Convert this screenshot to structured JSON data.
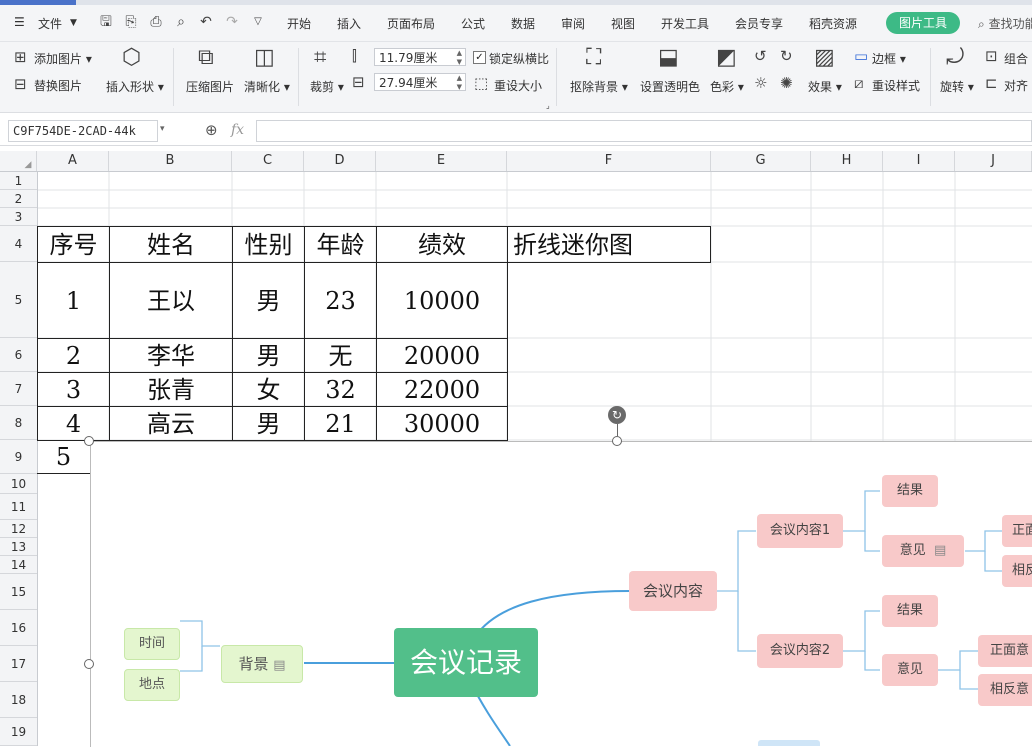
{
  "menu": {
    "file_label": "文件",
    "tabs": [
      "开始",
      "插入",
      "页面布局",
      "公式",
      "数据",
      "审阅",
      "视图",
      "开发工具",
      "会员专享",
      "稻壳资源"
    ],
    "active_tab": "图片工具",
    "search_label": "查找功能"
  },
  "ribbon": {
    "add_picture": "添加图片",
    "replace_picture": "替换图片",
    "insert_shape": "插入形状",
    "compress_picture": "压缩图片",
    "sharpen": "清晰化",
    "crop": "裁剪",
    "width_value": "11.79厘米",
    "height_value": "27.94厘米",
    "lock_ratio": "锁定纵横比",
    "reset_size": "重设大小",
    "remove_background": "抠除背景",
    "set_transparent": "设置透明色",
    "color": "色彩",
    "effects": "效果",
    "border": "边框",
    "reset_style": "重设样式",
    "rotate": "旋转",
    "group": "组合",
    "align": "对齐"
  },
  "formula_bar": {
    "name_box": "C9F754DE-2CAD-44k",
    "fx_label": "fx",
    "formula": ""
  },
  "grid": {
    "columns": [
      "A",
      "B",
      "C",
      "D",
      "E",
      "F",
      "G",
      "H",
      "I",
      "J"
    ],
    "rows": [
      "1",
      "2",
      "3",
      "4",
      "5",
      "6",
      "7",
      "8",
      "9",
      "10",
      "11",
      "12",
      "13",
      "14",
      "15",
      "16",
      "17",
      "18",
      "19"
    ]
  },
  "table": {
    "headers": [
      "序号",
      "姓名",
      "性别",
      "年龄",
      "绩效",
      "折线迷你图"
    ],
    "rows": [
      [
        "1",
        "王以",
        "男",
        "23",
        "10000"
      ],
      [
        "2",
        "李华",
        "男",
        "无",
        "20000"
      ],
      [
        "3",
        "张青",
        "女",
        "32",
        "22000"
      ],
      [
        "4",
        "高云",
        "男",
        "21",
        "30000"
      ]
    ],
    "extra_a9": "5"
  },
  "mindmap": {
    "root": "会议记录",
    "background": "背景",
    "time": "时间",
    "place": "地点",
    "content": "会议内容",
    "content1": "会议内容1",
    "content2": "会议内容2",
    "result1": "结果",
    "opinion1": "意见",
    "result2": "结果",
    "opinion2": "意见",
    "positive": "正面意",
    "negative": "相反意",
    "positive_cut": "正面",
    "negative_cut": "相反"
  },
  "colors": {
    "root_node": "#52bf8a",
    "pink_node": "#f8c9c9",
    "green_node": "#e4f6cf",
    "link_blue": "#4a9fdc",
    "accent_tab": "#3dba86"
  }
}
